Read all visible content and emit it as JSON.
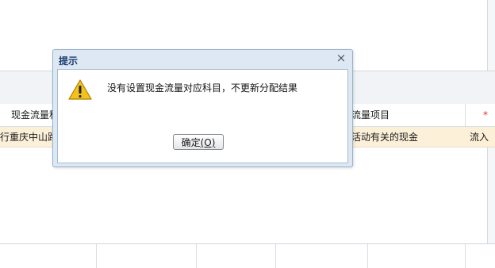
{
  "grid": {
    "header_col1": "现金流量科",
    "header_col2": "流量项目",
    "header_col3": "*",
    "row_col1": "行重庆中山路",
    "row_col2": "活动有关的现金",
    "row_col3": "流入"
  },
  "dialog": {
    "title": "提示",
    "close_glyph": "×",
    "message": "没有设置现金流量对应科目，不更新分配结果",
    "ok_label": "确定",
    "ok_shortcut": "(O)"
  },
  "colors": {
    "row_highlight": "#fdf0d9",
    "dialog_frame": "#dde8f3",
    "title_text": "#1c3d6e",
    "asterisk": "#e03030",
    "warning_yellow": "#f3c21b"
  },
  "icons": {
    "close": "close-icon",
    "warning": "warning-icon"
  }
}
